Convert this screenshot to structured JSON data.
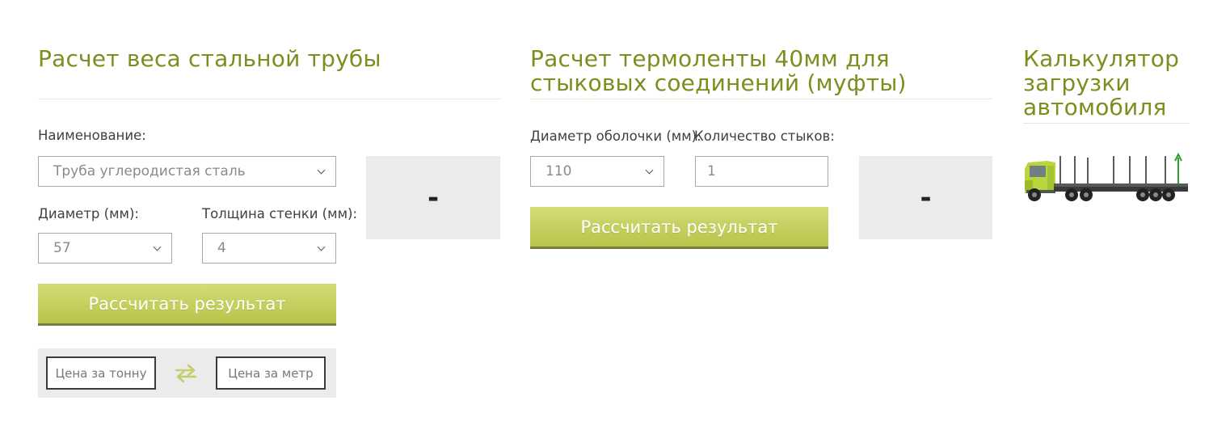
{
  "pipe_weight": {
    "title": "Расчет веса стальной трубы",
    "name_label": "Наименование:",
    "name_select_value": "Труба углеродистая сталь",
    "diameter_label": "Диаметр (мм):",
    "diameter_value": "57",
    "wall_label": "Толщина стенки (мм):",
    "wall_value": "4",
    "calc_button": "Рассчитать результат",
    "result": "-",
    "price_per_ton": "Цена за тонну",
    "price_per_meter": "Цена за метр"
  },
  "thermo_tape": {
    "title_line1": "Расчет термоленты 40мм для",
    "title_line2": "стыковых соединений (муфты)",
    "shell_diameter_label": "Диаметр оболочки (мм):",
    "shell_diameter_value": "110",
    "joints_label": "Количество стыков:",
    "joints_value": "1",
    "calc_button": "Рассчитать результат",
    "result": "-"
  },
  "truck_calc": {
    "title_line1": "Калькулятор",
    "title_line2": "загрузки",
    "title_line3": "автомобиля"
  },
  "colors": {
    "title": "#7d8d1e",
    "button_top": "#d4dc76",
    "button_bottom": "#b7c44a",
    "panel_bg": "#ebebeb"
  },
  "icons": {
    "swap": "swap-arrows-icon",
    "select": "chevron-down-icon",
    "truck": "timber-truck-icon"
  }
}
